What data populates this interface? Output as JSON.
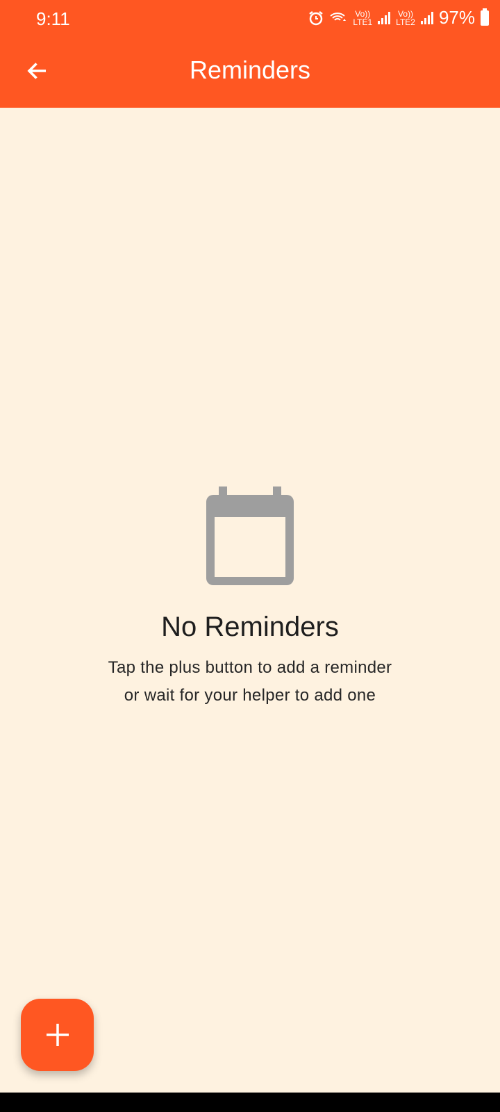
{
  "status_bar": {
    "time": "9:11",
    "sim1_label": "Vo))",
    "sim1_net": "LTE1",
    "sim2_label": "Vo))",
    "sim2_net": "LTE2",
    "battery": "97%"
  },
  "app_bar": {
    "title": "Reminders",
    "back_icon": "arrow-back-icon"
  },
  "empty_state": {
    "icon": "calendar-icon",
    "heading": "No Reminders",
    "line1": "Tap the plus button to add a reminder",
    "line2": "or wait for your helper to add one"
  },
  "fab": {
    "icon": "plus-icon"
  },
  "colors": {
    "primary": "#FF5722",
    "background": "#FEF2E0",
    "icon_gray": "#9E9E9E"
  }
}
